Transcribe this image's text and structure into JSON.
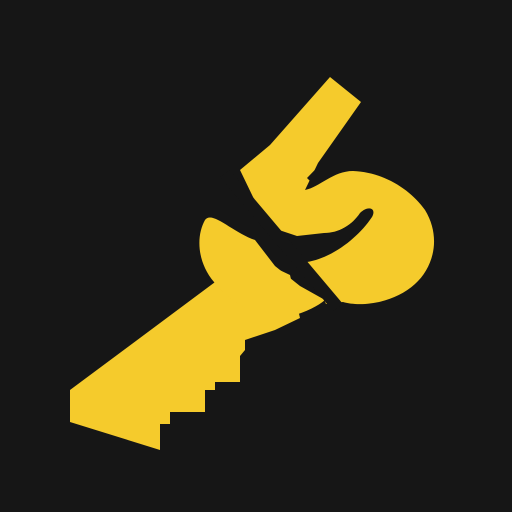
{
  "icon": {
    "name": "key-5-icon",
    "background_color": "#161616",
    "key_color": "#F5CB2C",
    "divider_color": "#161616",
    "glyph_color": "#161616"
  }
}
